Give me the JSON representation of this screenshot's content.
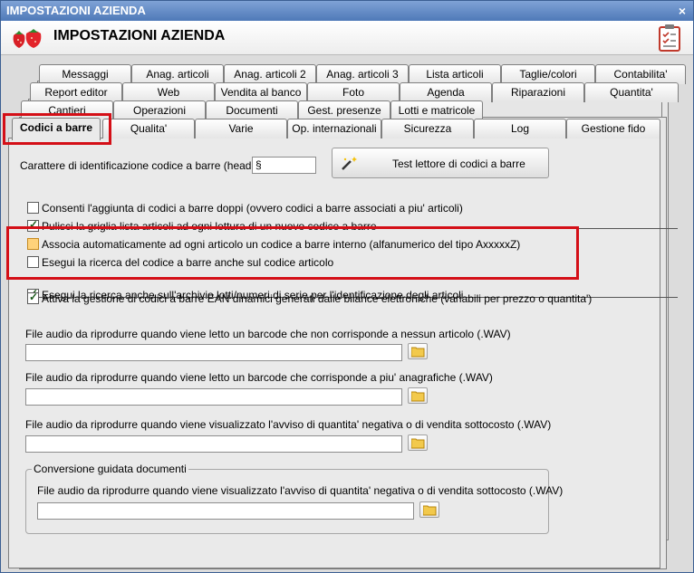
{
  "window": {
    "title": "IMPOSTAZIONI AZIENDA",
    "close_glyph": "×"
  },
  "header": {
    "title": "IMPOSTAZIONI AZIENDA",
    "logo_icon": "strawberry-icon",
    "right_icon": "checklist-icon"
  },
  "tabs": {
    "row1": [
      "Messaggi",
      "Anag. articoli",
      "Anag. articoli 2",
      "Anag. articoli 3",
      "Lista articoli",
      "Taglie/colori",
      "Contabilita'"
    ],
    "row2": [
      "Report editor",
      "Web",
      "Vendita al banco",
      "Foto",
      "Agenda",
      "Riparazioni",
      "Quantita'"
    ],
    "row3": [
      "Cantieri",
      "Operazioni",
      "Documenti",
      "Gest. presenze",
      "Lotti e matricole"
    ],
    "row4": [
      "Codici a barre",
      "Qualita'",
      "Varie",
      "Op. internazionali",
      "Sicurezza",
      "Log",
      "Gestione fido"
    ]
  },
  "content": {
    "header_char_label": "Carattere di identificazione codice a barre (header) :",
    "header_char_value": "§",
    "test_button_label": "Test lettore di codici a barre",
    "checkboxes": [
      {
        "label": "Consenti l'aggiunta di codici a barre doppi (ovvero codici a barre associati a piu' articoli)",
        "checked": false
      },
      {
        "label": "Pulisci la griglia lista articoli ad ogni lettura di un nuovo codice a barre",
        "checked": true
      },
      {
        "label": "Associa automaticamente ad ogni articolo un codice a barre interno (alfanumerico del tipo AxxxxxZ)",
        "checked": false
      },
      {
        "label": "Esegui la ricerca del codice a barre anche sul codice articolo",
        "checked": false
      },
      {
        "label": "Esegui la ricerca anche sull'archivio lotti/numeri di serie per l'identificazione degli articoli",
        "checked": true
      },
      {
        "label": "Attiva la gestione di codici a barre EAN dinamici generati dalle bilance elettroniche (variabili per prezzo o quantita')",
        "checked": true
      }
    ],
    "audio": [
      {
        "label": "File audio da riprodurre quando viene letto un barcode che non corrisponde a nessun articolo (.WAV)",
        "value": ""
      },
      {
        "label": "File audio da riprodurre quando viene letto un barcode che corrisponde a piu' anagrafiche (.WAV)",
        "value": ""
      },
      {
        "label": "File audio da riprodurre quando viene visualizzato l'avviso di quantita' negativa o di vendita sottocosto (.WAV)",
        "value": ""
      }
    ],
    "group": {
      "title": "Conversione guidata documenti",
      "audio_label": "File audio da riprodurre quando viene visualizzato l'avviso di quantita' negativa o di vendita sottocosto (.WAV)",
      "audio_value": ""
    }
  },
  "colors": {
    "annotation_red": "#d40f17",
    "title_blue": "#4f79b8"
  }
}
